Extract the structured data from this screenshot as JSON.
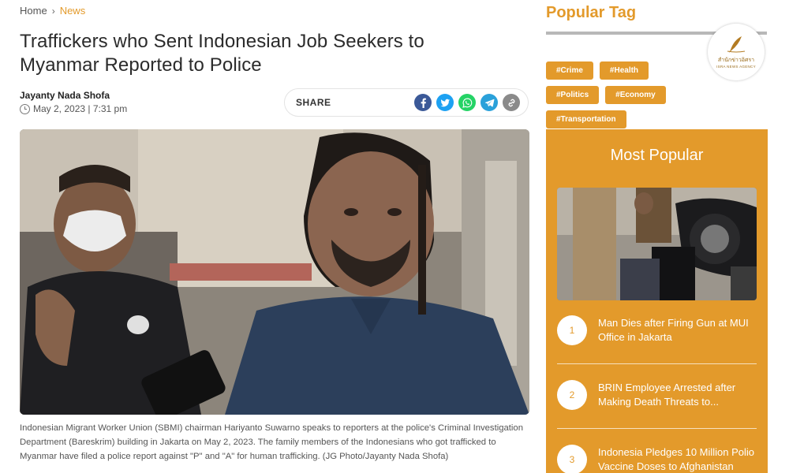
{
  "breadcrumb": {
    "home": "Home",
    "current": "News"
  },
  "article": {
    "title": "Traffickers who Sent Indonesian Job Seekers to Myanmar Reported to Police",
    "author": "Jayanty Nada Shofa",
    "date": "May 2, 2023 | 7:31 pm",
    "caption": "Indonesian Migrant Worker Union (SBMI) chairman Hariyanto Suwarno speaks to reporters at the police's Criminal Investigation Department (Bareskrim) building in Jakarta on May 2, 2023. The family members of the Indonesians who got trafficked to Myanmar have filed a police report against \"P\" and \"A\" for human trafficking. (JG Photo/Jayanty Nada Shofa)"
  },
  "share": {
    "label": "SHARE",
    "icons": [
      "facebook-icon",
      "twitter-icon",
      "whatsapp-icon",
      "telegram-icon",
      "link-icon"
    ]
  },
  "sidebar": {
    "popular_tag_heading": "Popular Tag",
    "tags": [
      "#Crime",
      "#Health",
      "#Politics",
      "#Economy",
      "#Transportation"
    ],
    "logo": {
      "line1": "สำนักข่าวอิศรา",
      "line2": "ISRA NEWS AGENCY"
    },
    "most_popular": {
      "heading": "Most Popular",
      "items": [
        {
          "num": "1",
          "title": "Man Dies after Firing Gun at MUI Office in Jakarta"
        },
        {
          "num": "2",
          "title": "BRIN Employee Arrested after Making Death Threats to..."
        },
        {
          "num": "3",
          "title": "Indonesia Pledges 10 Million Polio Vaccine Doses to Afghanistan"
        }
      ]
    }
  },
  "colors": {
    "accent": "#e39a2b",
    "facebook": "#3b5998",
    "twitter": "#1da1f2",
    "whatsapp": "#25d366",
    "telegram": "#2aa1da"
  }
}
